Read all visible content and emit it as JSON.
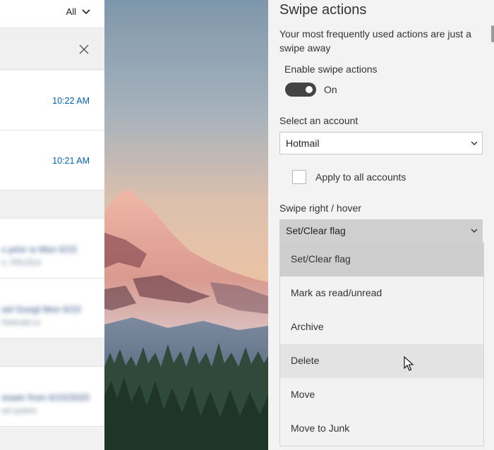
{
  "mail_list": {
    "filter_label": "All",
    "messages": [
      {
        "time": "10:22 AM"
      },
      {
        "time": "10:21 AM"
      }
    ],
    "blurred_items": [
      {
        "line1": "s prior w  Mon 6/15",
        "line2": "s, PAUSUi"
      },
      {
        "line1": "sel Googl  Mon 6/15",
        "line2": "Hotmail.cc"
      },
      {
        "line1": "sswer from  6/15/2020",
        "line2": "ed autom"
      }
    ]
  },
  "settings": {
    "title": "Swipe actions",
    "description": "Your most frequently used actions are just a swipe away",
    "enable_label": "Enable swipe actions",
    "toggle_state": "On",
    "account_label": "Select an account",
    "account_value": "Hotmail",
    "apply_all_label": "Apply to all accounts",
    "swipe_right_label": "Swipe right / hover",
    "swipe_right_value": "Set/Clear flag",
    "options": [
      "Set/Clear flag",
      "Mark as read/unread",
      "Archive",
      "Delete",
      "Move",
      "Move to Junk"
    ]
  },
  "colors": {
    "accent_time": "#0063b1",
    "pane_bg": "#f3f3f3",
    "toggle_on": "#444444"
  }
}
